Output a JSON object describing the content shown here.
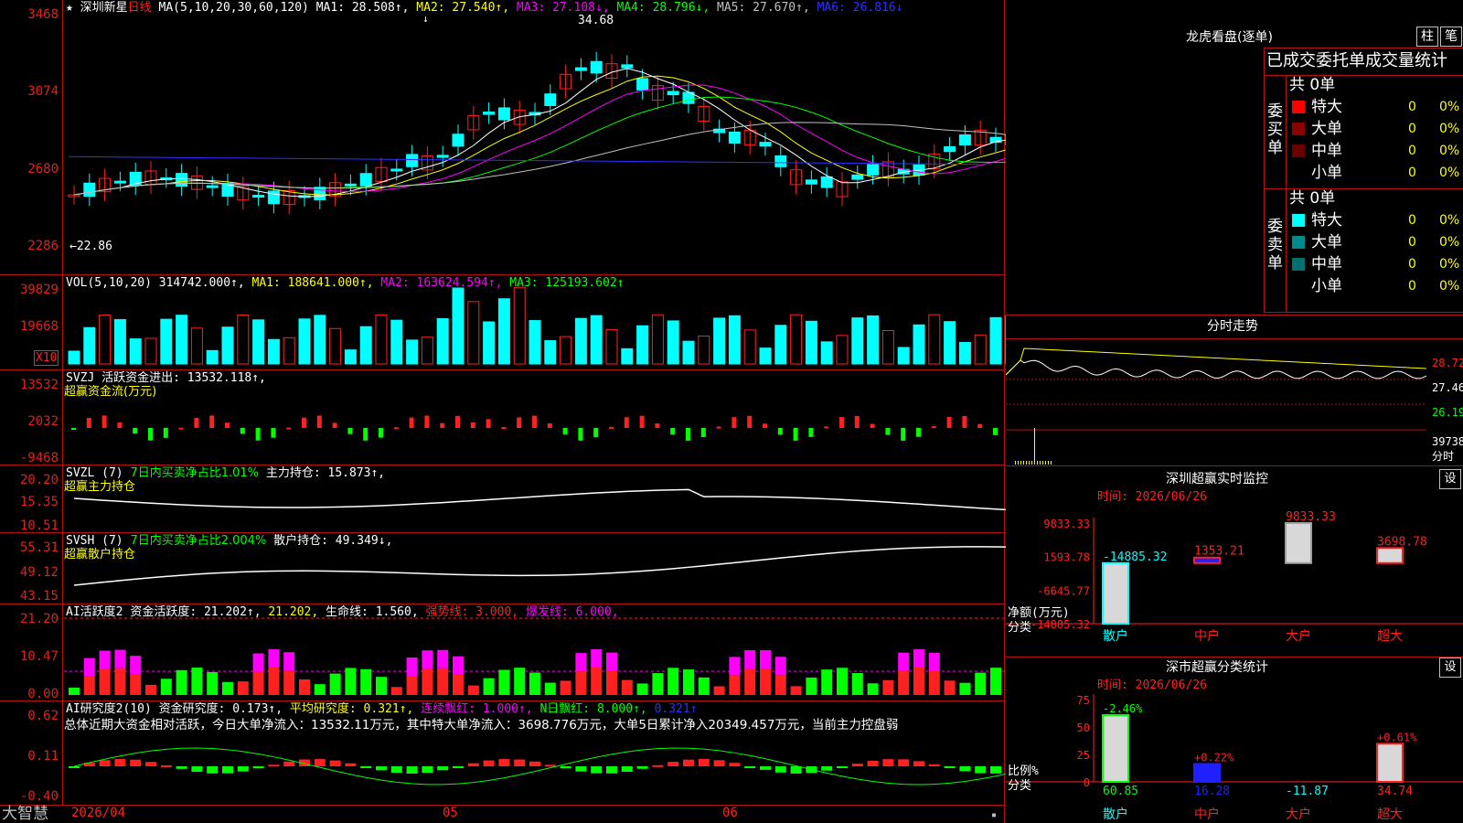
{
  "colors": {
    "grid": "#b01010",
    "up": "#ff2020",
    "down": "#00ffff",
    "yellow": "#ffff00",
    "magenta": "#ff00ff",
    "green": "#00ff00",
    "blue": "#3030ff",
    "white": "#ffffff"
  },
  "kline": {
    "star": "★",
    "stock_name": "深圳新星",
    "period": "日线",
    "ma_params": "MA(5,10,20,30,60,120)",
    "ma1": "MA1: 28.508↑,",
    "ma2": "MA2: 27.540↑,",
    "ma3": "MA3: 27.108↓,",
    "ma4": "MA4: 28.796↓,",
    "ma5": "MA5: 27.670↑,",
    "ma6": "MA6: 26.816↓",
    "y_labels": [
      "3468",
      "3074",
      "2680",
      "2286"
    ],
    "high_mark": "34.68",
    "low_mark": "←22.86",
    "down_arrow_mark": "↓"
  },
  "vol": {
    "header": "VOL(5,10,20)",
    "value": "314742.000↑,",
    "ma1": "MA1: 188641.000↑,",
    "ma2": "MA2: 163624.594↑,",
    "ma3": "MA3: 125193.602↑",
    "y_labels": [
      "39829",
      "19668"
    ],
    "unit": "X10"
  },
  "svzj": {
    "header": "SVZJ  活跃资金进出: 13532.118↑,",
    "subtitle": "超赢资金流(万元)",
    "y_labels": [
      "13532",
      "2032",
      "-9468"
    ]
  },
  "svzl": {
    "header": "SVZL (7)",
    "ratio": "7日内买卖净占比1.01%",
    "main": "主力持仓: 15.873↑,",
    "subtitle": "超赢主力持仓",
    "y_labels": [
      "20.20",
      "15.35",
      "10.51"
    ]
  },
  "svsh": {
    "header": "SVSH (7)",
    "ratio": "7日内买卖净占比2.004%",
    "main": "散户持仓: 49.349↓,",
    "subtitle": "超赢散户持仓",
    "y_labels": [
      "55.31",
      "49.12",
      "43.15"
    ]
  },
  "ai1": {
    "header": "AI活跃度2",
    "activity": "资金活跃度: 21.202↑,",
    "activity2": "21.202,",
    "life": "生命线: 1.560,",
    "strong": "强势线: 3.000,",
    "burst": "爆发线: 6.000,",
    "y_labels": [
      "21.20",
      "10.47",
      "0.00"
    ]
  },
  "ai2": {
    "header": "AI研究度2(10)",
    "research": "资金研究度: 0.173↑,",
    "avg": "平均研究度: 0.321↑,",
    "cont": "连续飘红: 1.000↑,",
    "nday": "N日飘红: 8.000↑,",
    "last": "0.321↑",
    "summary": "总体近期大资金相对活跃，今日大单净流入：13532.11万元，其中特大单净流入：3698.776万元，大单5日累计净入20349.457万元，当前主力控盘弱",
    "y_labels": [
      "0.62",
      "0.11",
      "-0.40"
    ]
  },
  "xaxis": {
    "brand": "大智慧",
    "date": "2026/04",
    "m05": "05",
    "m06": "06"
  },
  "dragon": {
    "title": "龙虎看盘(逐单)",
    "tab_bar": "柱",
    "tab_count": "笔",
    "subtitle": "已成交委托单成交量统计",
    "buy_label": "委买单",
    "sell_label": "委卖单",
    "buy_total": "共 0单",
    "sell_total": "共 0单",
    "buy_rows": [
      {
        "label": "特大",
        "count": "0",
        "pct": "0%",
        "color": "#ff0000"
      },
      {
        "label": "大单",
        "count": "0",
        "pct": "0%",
        "color": "#8b0000"
      },
      {
        "label": "中单",
        "count": "0",
        "pct": "0%",
        "color": "#6b0000"
      },
      {
        "label": "小单",
        "count": "0",
        "pct": "0%",
        "color": "#000000"
      }
    ],
    "sell_rows": [
      {
        "label": "特大",
        "count": "0",
        "pct": "0%",
        "color": "#00ffff"
      },
      {
        "label": "大单",
        "count": "0",
        "pct": "0%",
        "color": "#008b8b"
      },
      {
        "label": "中单",
        "count": "0",
        "pct": "0%",
        "color": "#007070"
      },
      {
        "label": "小单",
        "count": "0",
        "pct": "0%",
        "color": "#000000"
      }
    ]
  },
  "intraday": {
    "title": "分时走势",
    "prices": [
      "28.72",
      "27.46",
      "26.19"
    ],
    "vol": "39738",
    "unit": "分时"
  },
  "monitor": {
    "title": "深圳超赢实时监控",
    "settings": "设",
    "time": "时间: 2026/06/26",
    "y_labels": [
      "9833.33",
      "1593.78",
      "-6645.77",
      "-14885.32"
    ],
    "axis_label": "净额(万元)",
    "axis_sub": "分类",
    "chart_data": {
      "type": "bar",
      "categories": [
        "散户",
        "中户",
        "大户",
        "超大"
      ],
      "values": [
        -14885.32,
        1353.21,
        9833.33,
        3698.78
      ],
      "value_labels": [
        "-14885.32",
        "1353.21",
        "9833.33",
        "3698.78"
      ],
      "ylim": [
        -14885.32,
        9833.33
      ]
    }
  },
  "classify": {
    "title": "深市超赢分类统计",
    "settings": "设",
    "time": "时间: 2026/06/26",
    "y_labels": [
      "75",
      "50",
      "25",
      "0"
    ],
    "axis_label": "比例%",
    "axis_sub": "分类",
    "chart_data": {
      "type": "bar",
      "categories": [
        "散户",
        "中户",
        "大户",
        "超大"
      ],
      "values": [
        60.85,
        16.28,
        -11.87,
        34.74
      ],
      "value_labels": [
        "60.85",
        "16.28",
        "-11.87",
        "34.74"
      ],
      "change_labels": [
        "-2.46%",
        "+0.22%",
        "",
        "+0.61%"
      ],
      "ylim": [
        0,
        75
      ]
    }
  }
}
